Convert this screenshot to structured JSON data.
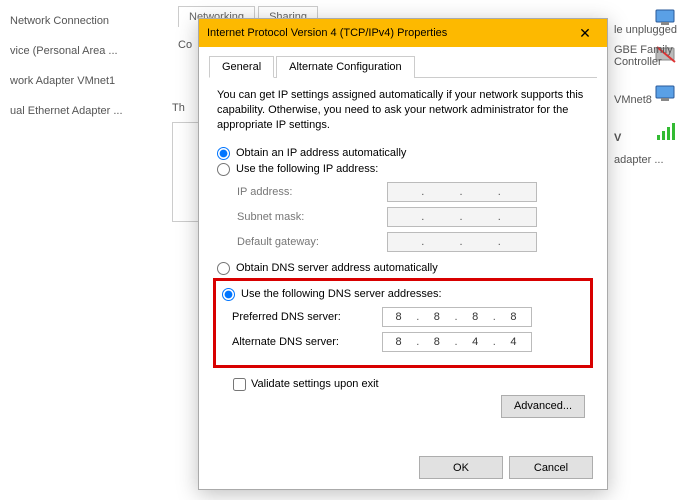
{
  "bg": {
    "header": "Network Connection",
    "items": [
      "vice (Personal Area ...",
      "work Adapter VMnet1",
      "ual Ethernet Adapter ..."
    ],
    "tabs": {
      "networking": "Networking",
      "sharing": "Sharing"
    },
    "co": "Co",
    "th": "Th"
  },
  "right": {
    "t1": "le unplugged",
    "t2": "GBE Family Controller",
    "t3": "VMnet8",
    "t4": "V",
    "t5": "adapter ..."
  },
  "dialog": {
    "title": "Internet Protocol Version 4 (TCP/IPv4) Properties",
    "close": "✕",
    "tabs": {
      "general": "General",
      "alt": "Alternate Configuration"
    },
    "intro": "You can get IP settings assigned automatically if your network supports this capability. Otherwise, you need to ask your network administrator for the appropriate IP settings.",
    "ip": {
      "auto": "Obtain an IP address automatically",
      "manual": "Use the following IP address:",
      "addr_label": "IP address:",
      "mask_label": "Subnet mask:",
      "gw_label": "Default gateway:"
    },
    "dns": {
      "auto": "Obtain DNS server address automatically",
      "manual": "Use the following DNS server addresses:",
      "pref_label": "Preferred DNS server:",
      "alt_label": "Alternate DNS server:",
      "pref": {
        "a": "8",
        "b": "8",
        "c": "8",
        "d": "8"
      },
      "altv": {
        "a": "8",
        "b": "8",
        "c": "4",
        "d": "4"
      }
    },
    "validate": "Validate settings upon exit",
    "advanced": "Advanced...",
    "ok": "OK",
    "cancel": "Cancel"
  }
}
